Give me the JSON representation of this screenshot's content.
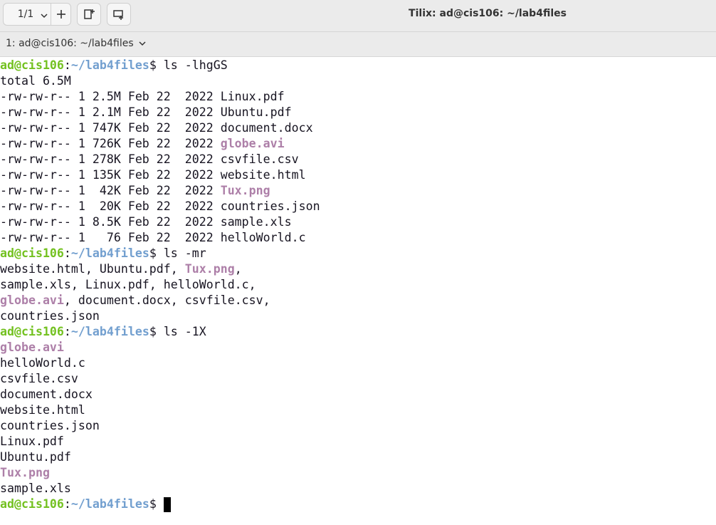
{
  "titlebar": {
    "session_count": "1/1",
    "window_title": "Tilix: ad@cis106: ~/lab4files"
  },
  "tab": {
    "label": "1: ad@cis106: ~/lab4files"
  },
  "prompt": {
    "user_host": "ad@cis106",
    "sep": ":",
    "path": "~/lab4files",
    "dollar": "$ "
  },
  "commands": {
    "c1": "ls -lhgGS",
    "c2": "ls -mr",
    "c3": "ls -1X"
  },
  "listing": {
    "total": "total 6.5M",
    "rows": [
      {
        "meta": "-rw-rw-r-- 1 2.5M Feb 22  2022 ",
        "name": "Linux.pdf",
        "media": false
      },
      {
        "meta": "-rw-rw-r-- 1 2.1M Feb 22  2022 ",
        "name": "Ubuntu.pdf",
        "media": false
      },
      {
        "meta": "-rw-rw-r-- 1 747K Feb 22  2022 ",
        "name": "document.docx",
        "media": false
      },
      {
        "meta": "-rw-rw-r-- 1 726K Feb 22  2022 ",
        "name": "globe.avi",
        "media": true
      },
      {
        "meta": "-rw-rw-r-- 1 278K Feb 22  2022 ",
        "name": "csvfile.csv",
        "media": false
      },
      {
        "meta": "-rw-rw-r-- 1 135K Feb 22  2022 ",
        "name": "website.html",
        "media": false
      },
      {
        "meta": "-rw-rw-r-- 1  42K Feb 22  2022 ",
        "name": "Tux.png",
        "media": true
      },
      {
        "meta": "-rw-rw-r-- 1  20K Feb 22  2022 ",
        "name": "countries.json",
        "media": false
      },
      {
        "meta": "-rw-rw-r-- 1 8.5K Feb 22  2022 ",
        "name": "sample.xls",
        "media": false
      },
      {
        "meta": "-rw-rw-r-- 1   76 Feb 22  2022 ",
        "name": "helloWorld.c",
        "media": false
      }
    ]
  },
  "comma_list": {
    "l1a": "website.html, Ubuntu.pdf, ",
    "l1b": "Tux.png",
    "l1c": ",",
    "l2": "sample.xls, Linux.pdf, helloWorld.c,",
    "l3a": "globe.avi",
    "l3b": ", document.docx, csvfile.csv,",
    "l4": "countries.json"
  },
  "one_per_line": [
    {
      "name": "globe.avi",
      "media": true
    },
    {
      "name": "helloWorld.c",
      "media": false
    },
    {
      "name": "csvfile.csv",
      "media": false
    },
    {
      "name": "document.docx",
      "media": false
    },
    {
      "name": "website.html",
      "media": false
    },
    {
      "name": "countries.json",
      "media": false
    },
    {
      "name": "Linux.pdf",
      "media": false
    },
    {
      "name": "Ubuntu.pdf",
      "media": false
    },
    {
      "name": "Tux.png",
      "media": true
    },
    {
      "name": "sample.xls",
      "media": false
    }
  ],
  "colors": {
    "prompt_user": "#73c120",
    "prompt_path": "#729fcf",
    "media_file": "#ad7fa8",
    "text": "#171421",
    "background": "#ffffff"
  },
  "icons": {
    "session_dropdown": "chevron-down-icon",
    "add_session": "plus-icon",
    "add_terminal_right": "split-right-icon",
    "add_terminal_down": "split-down-icon"
  }
}
